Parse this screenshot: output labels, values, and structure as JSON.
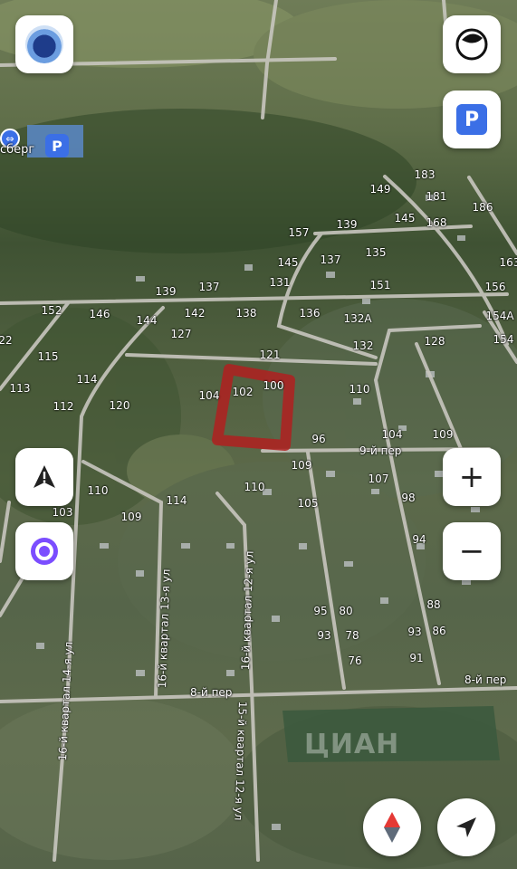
{
  "map": {
    "house_numbers": [
      "183",
      "181",
      "186",
      "149",
      "145",
      "168",
      "139",
      "157",
      "135",
      "145",
      "137",
      "131",
      "151",
      "156",
      "139",
      "137",
      "142",
      "138",
      "136",
      "132А",
      "154А",
      "152",
      "146",
      "144",
      "127",
      "121",
      "132",
      "128",
      "154",
      "115",
      "114",
      "113",
      "112",
      "120",
      "104",
      "102",
      "100",
      "110",
      "96",
      "104",
      "109",
      "109",
      "107",
      "98",
      "110",
      "114",
      "110",
      "105",
      "103",
      "109",
      "94",
      "80",
      "88",
      "95",
      "93",
      "78",
      "86",
      "93",
      "91",
      "76",
      "22",
      "163"
    ],
    "street_names": [
      "9-й пер",
      "8-й пер",
      "8-й пер",
      "16-й квартал 14-я ул",
      "16-й квартал 13-я ул",
      "16-й квартал 12-я ул",
      "15-й квартал 12-я ул"
    ],
    "poi_label": "сберг",
    "watermark": "ЦИАН"
  },
  "controls": {
    "parking_label": "P",
    "zoom_in_label": "+",
    "zoom_out_label": "−"
  },
  "colors": {
    "accent": "#3b6fe6",
    "alice": "#7b4dff",
    "plot": "#b02020"
  }
}
